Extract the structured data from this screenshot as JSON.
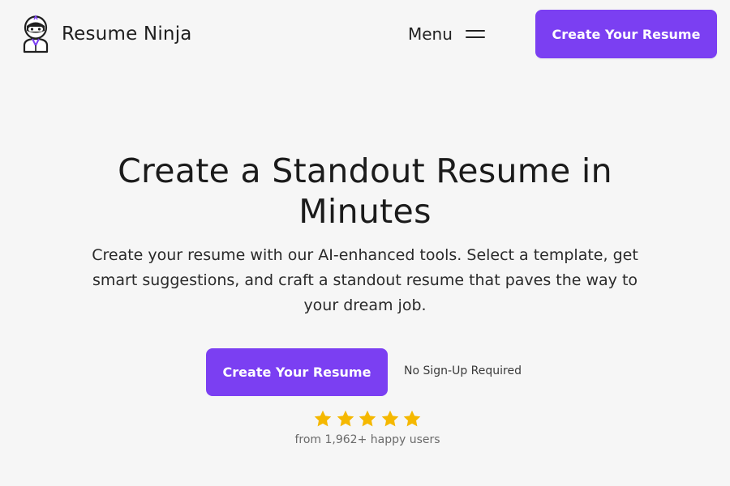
{
  "header": {
    "brand_name": "Resume Ninja",
    "logo_icon": "ninja-mascot-icon",
    "menu_label": "Menu",
    "menu_icon": "hamburger-icon",
    "cta_label": "Create Your Resume"
  },
  "hero": {
    "title": "Create a Standout Resume in Minutes",
    "subtitle": "Create your resume with our AI-enhanced tools. Select a template, get smart suggestions, and craft a standout resume that paves the way to your dream job.",
    "cta_label": "Create Your Resume",
    "note": "No Sign-Up Required"
  },
  "rating": {
    "stars": 5,
    "max_stars": 5,
    "star_icon": "star-icon",
    "text": "from 1,962+ happy users"
  },
  "colors": {
    "brand_accent": "#7b3ff2",
    "background": "#f6f6f6",
    "star": "#f5b800"
  }
}
